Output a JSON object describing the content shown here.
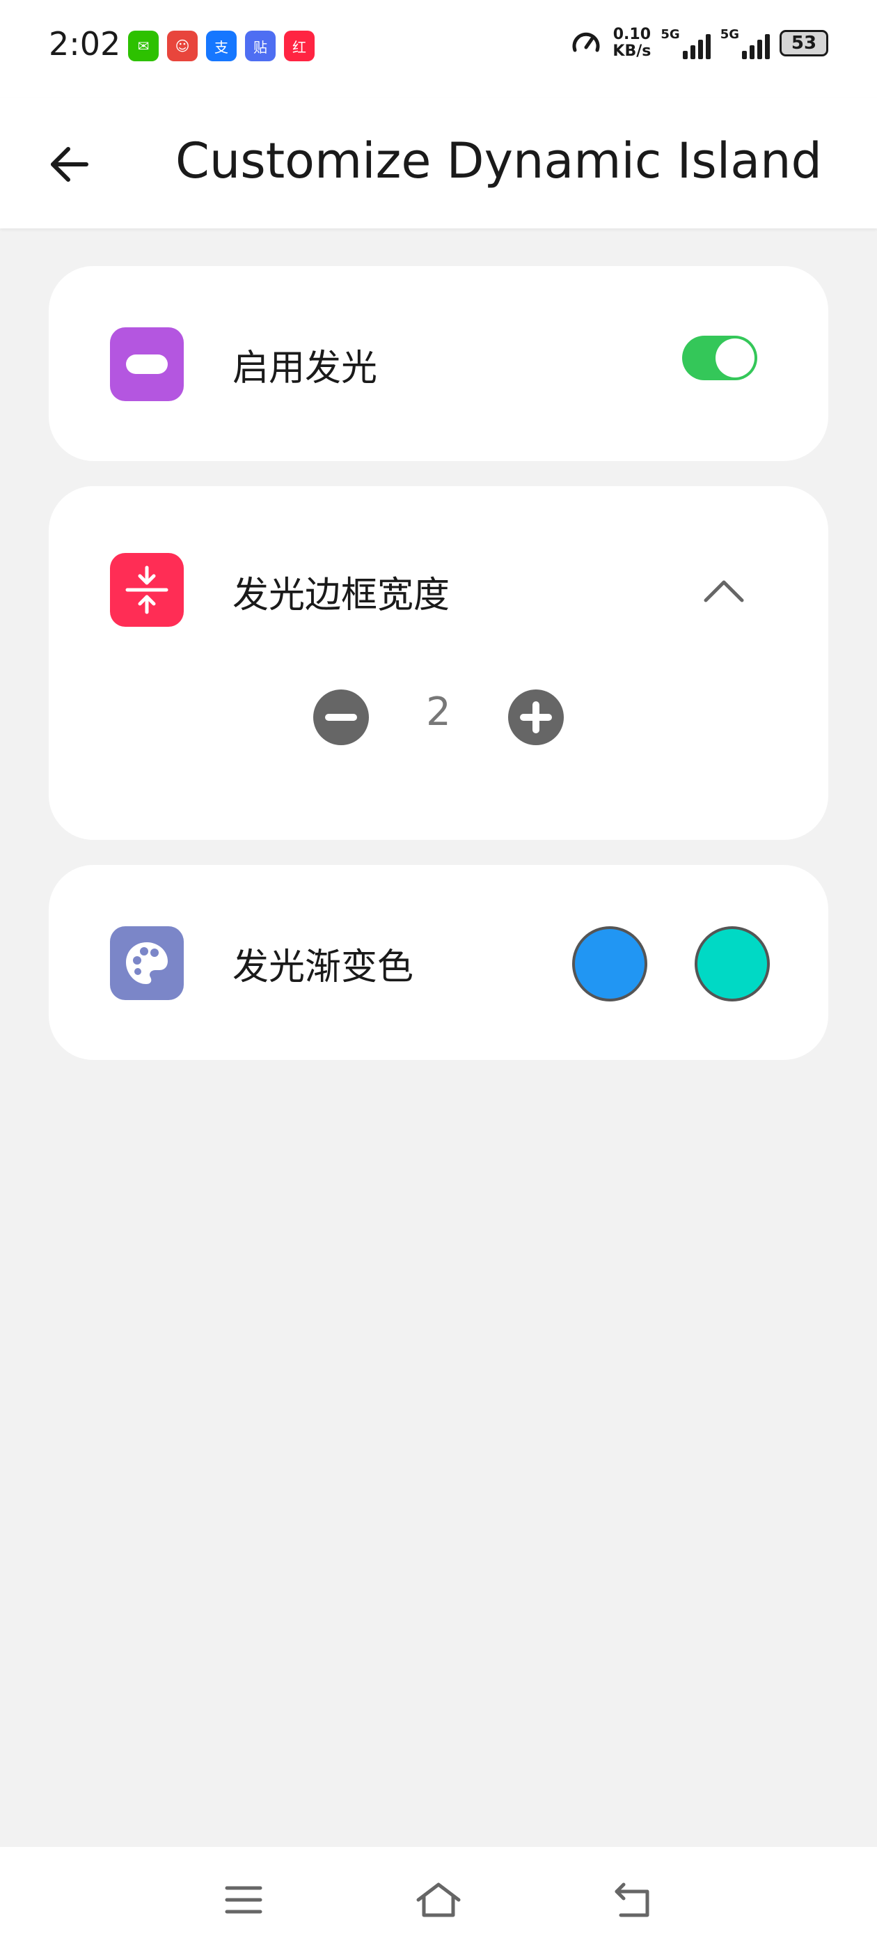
{
  "status_bar": {
    "time": "2:02",
    "notification_icons": [
      {
        "name": "wechat-icon",
        "color": "#2dc100",
        "glyph": "✉"
      },
      {
        "name": "clown-app-icon",
        "color": "#e8453c",
        "glyph": "☺"
      },
      {
        "name": "alipay-icon",
        "color": "#1677ff",
        "glyph": "支"
      },
      {
        "name": "tieba-icon",
        "color": "#4e6ef2",
        "glyph": "贴"
      },
      {
        "name": "xiaohongshu-icon",
        "color": "#ff2442",
        "glyph": "红"
      }
    ],
    "speed_value": "0.10",
    "speed_unit": "KB/s",
    "sim1_label": "5G",
    "sim2_label": "5G",
    "battery": "53"
  },
  "app_bar": {
    "back_icon": "arrow-left-icon",
    "title": "Customize Dynamic Island"
  },
  "cards": {
    "glow": {
      "icon": "pill-icon",
      "icon_color": "#b456e0",
      "label": "启用发光",
      "toggle_on": true,
      "toggle_color": "#34c759"
    },
    "border_width": {
      "icon": "compress-vertical-icon",
      "icon_color": "#ff2d55",
      "label": "发光边框宽度",
      "expanded": true,
      "value": "2",
      "stepper_color": "#666666"
    },
    "gradient": {
      "icon": "palette-icon",
      "icon_color": "#7b86c8",
      "label": "发光渐变色",
      "colors": [
        "#2196f3",
        "#00d9c5"
      ]
    }
  },
  "nav_bar": {
    "icons": [
      "menu-icon",
      "home-icon",
      "back-icon"
    ]
  }
}
